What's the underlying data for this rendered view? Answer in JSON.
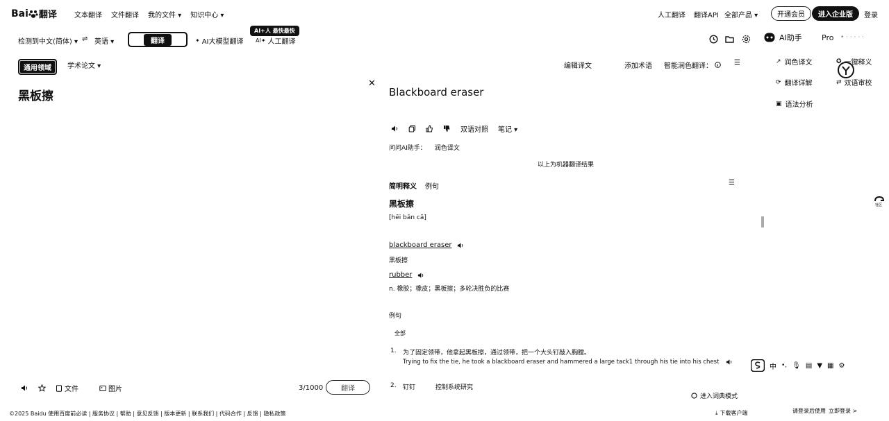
{
  "header": {
    "logo_text": "Bai",
    "logo_suffix": "翻译",
    "nav": [
      "文本翻译",
      "文件翻译",
      "我的文件 ▾",
      "知识中心 ▾"
    ],
    "right": {
      "human_translate": "人工翻译",
      "api": "翻译API",
      "all_products": "全部产品 ▾",
      "vip": "开通会员",
      "enterprise": "进入企业版",
      "login": "登录"
    }
  },
  "toolbar": {
    "source_lang": "检测到中文(简体) ▾",
    "swap": "⇌",
    "target_lang": "英语 ▾",
    "translate_btn": "翻译",
    "ai_model": "AI大模型翻译",
    "human": "人工翻译",
    "ai_badge": "AI+人 最快最快",
    "ai_assistant": "AI助手",
    "pro": "Pro"
  },
  "domain": {
    "general": "通用领域",
    "academic": "学术论文 ▾"
  },
  "output_toolbar": {
    "edit": "编辑译文",
    "add_term": "添加术语",
    "smart_polish": "智能润色翻译：",
    "menu": "☰"
  },
  "ai_panel": {
    "polish": "润色译文",
    "explain": "一键释义",
    "detail": "翻译详解",
    "reverse": "双语审校",
    "grammar": "语法分析"
  },
  "source": {
    "text": "黑板擦",
    "file": "文件",
    "image": "图片",
    "count": "3/1000",
    "translate": "翻译"
  },
  "result": {
    "text": "Blackboard eraser",
    "bilingual": "双语对照",
    "note": "笔记 ▾",
    "ask_ai": "问问AI助手：",
    "polish_link": "润色译文",
    "machine_note": "以上为机器翻译结果",
    "tab_def": "简明释义",
    "tab_example": "例句",
    "headword": "黑板擦",
    "pinyin": "[hēi bǎn cā]",
    "entry1_word": "blackboard eraser",
    "entry1_def": "黑板擦",
    "entry2_word": "rubber",
    "entry2_def": "n. 橡胶；橡皮；黑板擦；多轮决胜负的比赛",
    "examples_title": "例句",
    "filter_all": "全部",
    "ex1_num": "1.",
    "ex1_zh": "为了固定领带，他拿起黑板擦，通过领带，把一个大头钉敲入胸膛。",
    "ex1_en": "Trying to fix the tie, he took a blackboard eraser and hammered a large tack1 through his tie into his chest",
    "ex2_num": "2.",
    "ex2_zh": "钉钉",
    "ex2_more": "控制系统研究",
    "dict_mode": "进入词典模式"
  },
  "footer": {
    "links": "©2025 Baidu  使用百度前必读 | 服务协议 | 帮助 | 意见反馈 | 版本更新 | 联系我们 | 代码合作 | 反馈 | 隐私政策",
    "download": "下载客户端",
    "login_hint": "请登录后使用",
    "login_link": "立即登录 >"
  }
}
